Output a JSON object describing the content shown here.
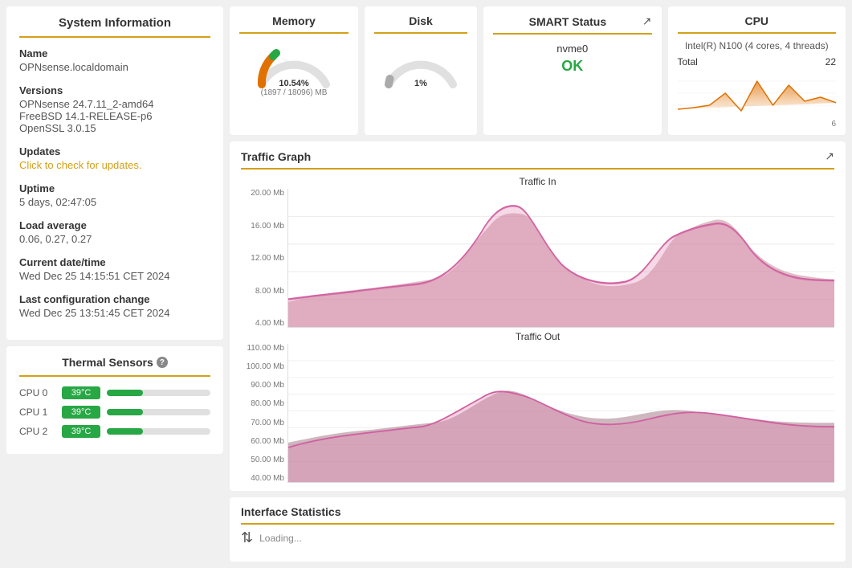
{
  "left": {
    "system_info_title": "System Information",
    "name_label": "Name",
    "name_value": "OPNsense.localdomain",
    "versions_label": "Versions",
    "version1": "OPNsense 24.7.11_2-amd64",
    "version2": "FreeBSD 14.1-RELEASE-p6",
    "version3": "OpenSSL 3.0.15",
    "updates_label": "Updates",
    "updates_link": "Click to check for updates.",
    "uptime_label": "Uptime",
    "uptime_value": "5 days, 02:47:05",
    "load_label": "Load average",
    "load_value": "0.06, 0.27, 0.27",
    "datetime_label": "Current date/time",
    "datetime_value": "Wed Dec 25 14:15:51 CET 2024",
    "lastconfig_label": "Last configuration change",
    "lastconfig_value": "Wed Dec 25 13:51:45 CET 2024",
    "thermal_title": "Thermal Sensors",
    "thermal_sensors": [
      {
        "label": "CPU 0",
        "temp": "39°C",
        "pct": 35
      },
      {
        "label": "CPU 1",
        "temp": "39°C",
        "pct": 35
      },
      {
        "label": "CPU 2",
        "temp": "39°C",
        "pct": 35
      }
    ]
  },
  "memory": {
    "title": "Memory",
    "percent_label": "10.54%",
    "detail": "(1897 / 18096) MB"
  },
  "disk": {
    "title": "Disk",
    "percent_label": "1%"
  },
  "smart": {
    "title": "SMART Status",
    "device": "nvme0",
    "status": "OK"
  },
  "cpu": {
    "title": "CPU",
    "info": "Intel(R) N100 (4 cores, 4 threads)",
    "chart_label": "Total",
    "max_value": "22",
    "min_value": "6"
  },
  "traffic": {
    "title": "Traffic Graph",
    "in_label": "Traffic In",
    "out_label": "Traffic Out",
    "in_y_labels": [
      "20.00 Mb",
      "16.00 Mb",
      "12.00 Mb",
      "8.00 Mb",
      "4.00 Mb"
    ],
    "out_y_labels": [
      "110.00 Mb",
      "100.00 Mb",
      "90.00 Mb",
      "80.00 Mb",
      "70.00 Mb",
      "60.00 Mb",
      "50.00 Mb",
      "40.00 Mb"
    ]
  },
  "interface": {
    "title": "Interface Statistics"
  }
}
